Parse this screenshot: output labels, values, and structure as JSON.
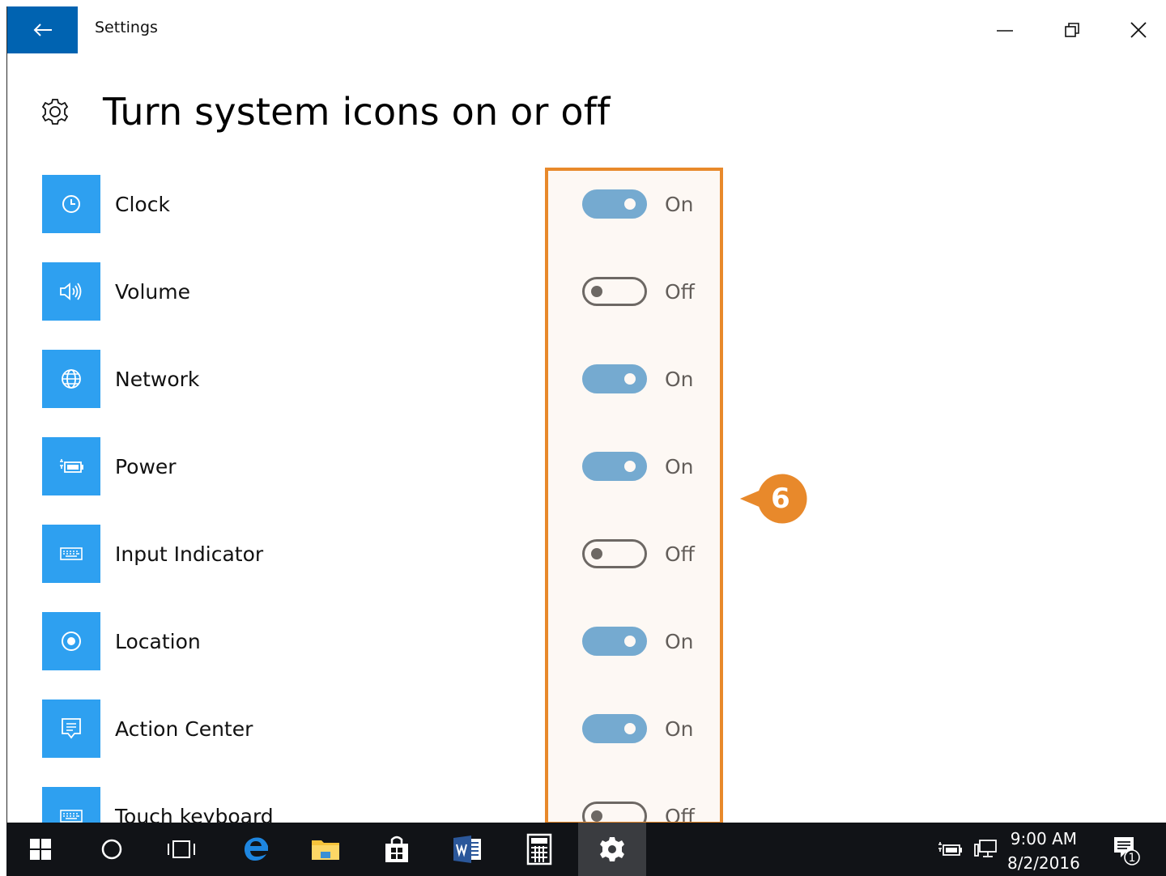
{
  "window": {
    "title": "Settings"
  },
  "page": {
    "title": "Turn system icons on or off"
  },
  "rows": [
    {
      "label": "Clock",
      "state": "On",
      "on": true,
      "icon": "clock-icon"
    },
    {
      "label": "Volume",
      "state": "Off",
      "on": false,
      "icon": "volume-icon"
    },
    {
      "label": "Network",
      "state": "On",
      "on": true,
      "icon": "globe-icon"
    },
    {
      "label": "Power",
      "state": "On",
      "on": true,
      "icon": "battery-icon"
    },
    {
      "label": "Input Indicator",
      "state": "Off",
      "on": false,
      "icon": "keyboard-icon"
    },
    {
      "label": "Location",
      "state": "On",
      "on": true,
      "icon": "location-icon"
    },
    {
      "label": "Action Center",
      "state": "On",
      "on": true,
      "icon": "action-center-icon"
    },
    {
      "label": "Touch keyboard",
      "state": "Off",
      "on": false,
      "icon": "keyboard-icon"
    }
  ],
  "callout": {
    "number": "6"
  },
  "taskbar": {
    "time": "9:00 AM",
    "date": "8/2/2016",
    "notification_count": "1"
  },
  "colors": {
    "accent": "#0063b1",
    "tile": "#2ea0f0",
    "toggle_on": "#2e87c8",
    "highlight": "#e8892b",
    "taskbar": "#111317"
  }
}
